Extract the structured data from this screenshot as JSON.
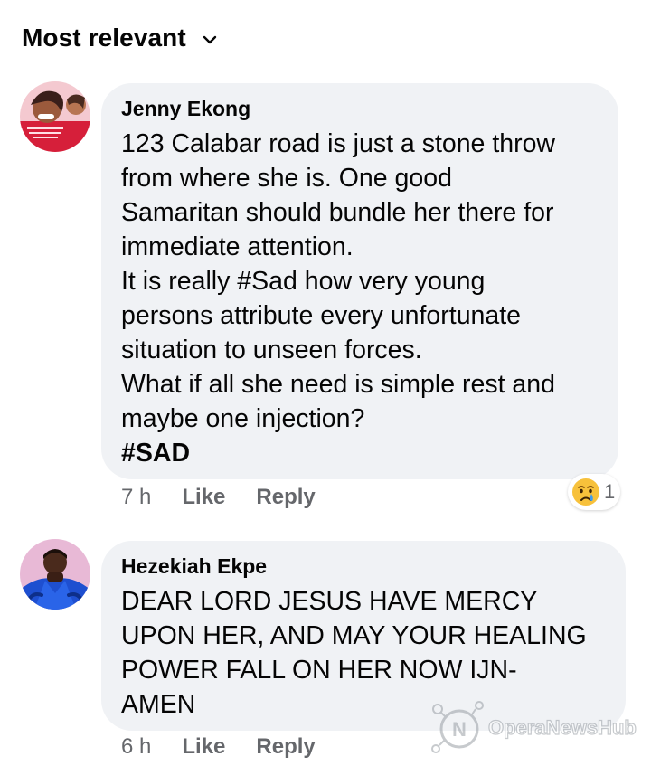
{
  "header": {
    "sort_label": "Most relevant"
  },
  "comments": [
    {
      "author": "Jenny Ekong",
      "lines": [
        "123 Calabar road is just a stone throw",
        "from where she is. One good",
        "Samaritan should bundle her there for",
        "immediate attention.",
        "It is really #Sad how very young",
        "persons attribute every unfortunate",
        "situation to unseen forces.",
        "What if all she need is simple rest and",
        "maybe one injection?",
        "#SAD"
      ],
      "time": "7 h",
      "like_label": "Like",
      "reply_label": "Reply",
      "reaction_count": "1"
    },
    {
      "author": "Hezekiah Ekpe",
      "lines": [
        "DEAR LORD JESUS HAVE MERCY",
        "UPON HER, AND MAY YOUR HEALING",
        "POWER FALL ON HER NOW IJN-",
        "AMEN"
      ],
      "time": "6 h",
      "like_label": "Like",
      "reply_label": "Reply"
    }
  ],
  "watermark": {
    "text": "OperaNewsHub"
  },
  "colors": {
    "bubble": "#f0f2f5",
    "meta": "#65676b",
    "text": "#050505"
  },
  "icons": [
    "chevron-down-icon",
    "crying-face-icon",
    "opera-news-logo-icon"
  ]
}
